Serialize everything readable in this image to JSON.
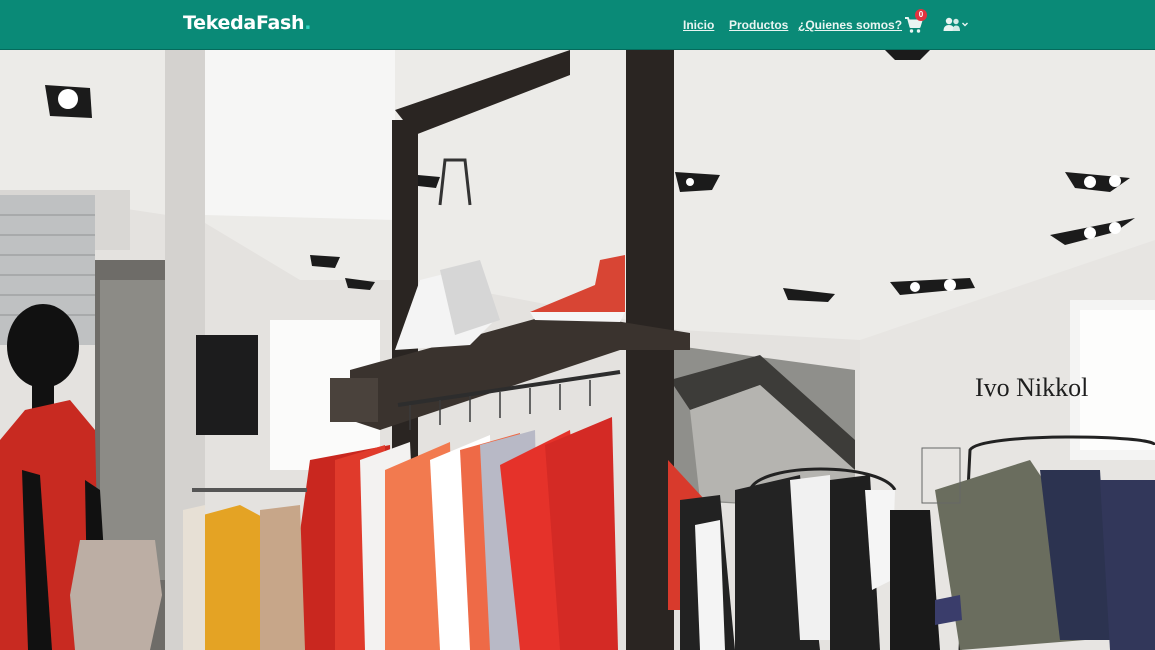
{
  "navbar": {
    "brand_text": "TekedaFash",
    "brand_dot": ".",
    "links": [
      {
        "label": "Inicio"
      },
      {
        "label": "Productos"
      },
      {
        "label": "¿Quienes somos?"
      }
    ],
    "cart_count": "0",
    "icons": {
      "cart": "shopping-cart-icon",
      "user": "users-icon",
      "caret": "chevron-down-icon"
    },
    "colors": {
      "background": "#0a8a77",
      "badge": "#e2323f",
      "brand_dot": "#2fd3c1"
    }
  },
  "hero": {
    "store_sign": "Ivo Nikkol"
  }
}
